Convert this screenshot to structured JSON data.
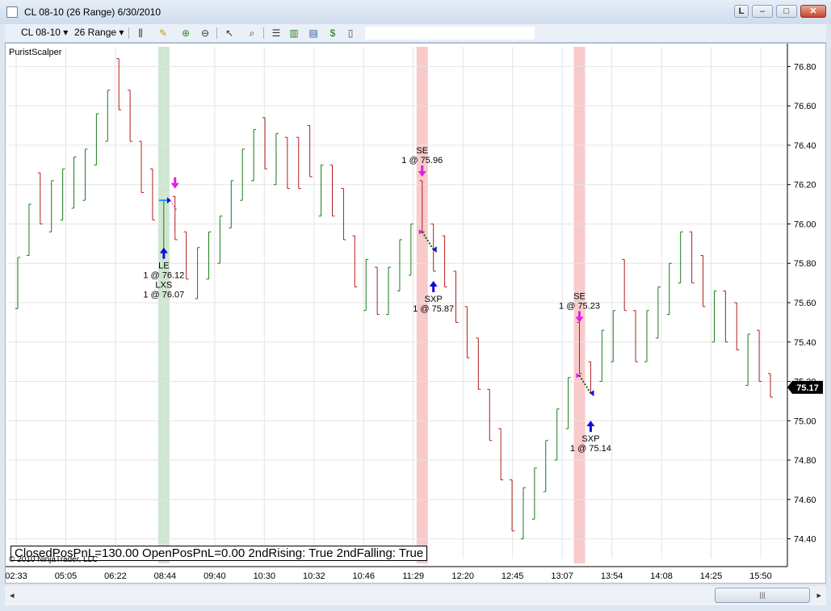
{
  "window": {
    "title": "CL 08-10 (26 Range)  6/30/2010"
  },
  "toolbar": {
    "instrument": "CL 08-10",
    "period": "26 Range"
  },
  "chart": {
    "strategy_label": "PuristScalper",
    "status_text": "ClosedPosPnL=130.00 OpenPosPnL=0.00 2ndRising: True 2ndFalling: True",
    "copyright": "© 2010 NinjaTrader, LLC",
    "last_price": "75.17"
  },
  "colors": {
    "up_bar": "#1a7a1a",
    "down_bar": "#b31d1d",
    "long_highlight": "#cfe6cf",
    "short_highlight": "#f8caca",
    "entry_arrow": "#e020e0",
    "exit_arrow": "#1010d0"
  },
  "chart_data": {
    "type": "range-bar",
    "y_axis": {
      "ticks": [
        "74.40",
        "74.60",
        "74.80",
        "75.00",
        "75.20",
        "75.40",
        "75.60",
        "75.80",
        "76.00",
        "76.20",
        "76.40",
        "76.60",
        "76.80"
      ],
      "ylim": [
        74.3,
        76.9
      ],
      "grid": true
    },
    "x_axis": {
      "ticks": [
        "02:33",
        "05:05",
        "06:22",
        "08:44",
        "09:40",
        "10:30",
        "10:32",
        "10:46",
        "11:29",
        "12:20",
        "12:45",
        "13:07",
        "13:54",
        "14:08",
        "14:25",
        "15:50"
      ]
    },
    "bars": [
      {
        "d": "up",
        "o": 75.57,
        "c": 75.83,
        "h": 75.83,
        "l": 75.57
      },
      {
        "d": "up",
        "o": 75.84,
        "c": 76.1,
        "h": 76.1,
        "l": 75.84
      },
      {
        "d": "down",
        "o": 76.26,
        "c": 76.0,
        "h": 76.26,
        "l": 76.0
      },
      {
        "d": "up",
        "o": 75.96,
        "c": 76.22,
        "h": 76.22,
        "l": 75.96
      },
      {
        "d": "up",
        "o": 76.02,
        "c": 76.28,
        "h": 76.28,
        "l": 76.02
      },
      {
        "d": "up",
        "o": 76.08,
        "c": 76.34,
        "h": 76.34,
        "l": 76.08
      },
      {
        "d": "up",
        "o": 76.12,
        "c": 76.38,
        "h": 76.38,
        "l": 76.12
      },
      {
        "d": "up",
        "o": 76.3,
        "c": 76.56,
        "h": 76.56,
        "l": 76.3
      },
      {
        "d": "up",
        "o": 76.42,
        "c": 76.68,
        "h": 76.68,
        "l": 76.42
      },
      {
        "d": "down",
        "o": 76.84,
        "c": 76.58,
        "h": 76.84,
        "l": 76.58
      },
      {
        "d": "down",
        "o": 76.68,
        "c": 76.42,
        "h": 76.68,
        "l": 76.42
      },
      {
        "d": "down",
        "o": 76.42,
        "c": 76.16,
        "h": 76.42,
        "l": 76.16
      },
      {
        "d": "down",
        "o": 76.28,
        "c": 76.02,
        "h": 76.28,
        "l": 76.02
      },
      {
        "d": "up",
        "o": 75.86,
        "c": 76.12,
        "h": 76.12,
        "l": 75.86
      },
      {
        "d": "down",
        "o": 76.14,
        "c": 75.92,
        "h": 76.14,
        "l": 75.92
      },
      {
        "d": "down",
        "o": 75.96,
        "c": 75.72,
        "h": 75.96,
        "l": 75.72
      },
      {
        "d": "up",
        "o": 75.62,
        "c": 75.88,
        "h": 75.88,
        "l": 75.62
      },
      {
        "d": "up",
        "o": 75.72,
        "c": 75.96,
        "h": 75.96,
        "l": 75.72
      },
      {
        "d": "up",
        "o": 75.8,
        "c": 76.04,
        "h": 76.04,
        "l": 75.8
      },
      {
        "d": "up",
        "o": 75.98,
        "c": 76.22,
        "h": 76.22,
        "l": 75.98
      },
      {
        "d": "up",
        "o": 76.12,
        "c": 76.38,
        "h": 76.38,
        "l": 76.12
      },
      {
        "d": "up",
        "o": 76.22,
        "c": 76.48,
        "h": 76.48,
        "l": 76.22
      },
      {
        "d": "down",
        "o": 76.54,
        "c": 76.28,
        "h": 76.54,
        "l": 76.28
      },
      {
        "d": "up",
        "o": 76.2,
        "c": 76.46,
        "h": 76.46,
        "l": 76.2
      },
      {
        "d": "down",
        "o": 76.44,
        "c": 76.18,
        "h": 76.44,
        "l": 76.18
      },
      {
        "d": "down",
        "o": 76.44,
        "c": 76.18,
        "h": 76.44,
        "l": 76.18
      },
      {
        "d": "down",
        "o": 76.5,
        "c": 76.24,
        "h": 76.5,
        "l": 76.24
      },
      {
        "d": "up",
        "o": 76.04,
        "c": 76.3,
        "h": 76.3,
        "l": 76.04
      },
      {
        "d": "down",
        "o": 76.3,
        "c": 76.04,
        "h": 76.3,
        "l": 76.04
      },
      {
        "d": "down",
        "o": 76.18,
        "c": 75.92,
        "h": 76.18,
        "l": 75.92
      },
      {
        "d": "down",
        "o": 75.94,
        "c": 75.68,
        "h": 75.94,
        "l": 75.68
      },
      {
        "d": "up",
        "o": 75.56,
        "c": 75.82,
        "h": 75.82,
        "l": 75.56
      },
      {
        "d": "down",
        "o": 75.78,
        "c": 75.54,
        "h": 75.78,
        "l": 75.54
      },
      {
        "d": "up",
        "o": 75.54,
        "c": 75.78,
        "h": 75.78,
        "l": 75.54
      },
      {
        "d": "up",
        "o": 75.66,
        "c": 75.92,
        "h": 75.92,
        "l": 75.66
      },
      {
        "d": "up",
        "o": 75.74,
        "c": 76.0,
        "h": 76.0,
        "l": 75.74
      },
      {
        "d": "down",
        "o": 76.22,
        "c": 75.96,
        "h": 76.22,
        "l": 75.96
      },
      {
        "d": "down",
        "o": 76.0,
        "c": 75.76,
        "h": 76.0,
        "l": 75.76
      },
      {
        "d": "down",
        "o": 75.94,
        "c": 75.68,
        "h": 75.94,
        "l": 75.68
      },
      {
        "d": "down",
        "o": 75.76,
        "c": 75.5,
        "h": 75.76,
        "l": 75.5
      },
      {
        "d": "down",
        "o": 75.58,
        "c": 75.32,
        "h": 75.58,
        "l": 75.32
      },
      {
        "d": "down",
        "o": 75.42,
        "c": 75.16,
        "h": 75.42,
        "l": 75.16
      },
      {
        "d": "down",
        "o": 75.16,
        "c": 74.9,
        "h": 75.16,
        "l": 74.9
      },
      {
        "d": "down",
        "o": 74.96,
        "c": 74.7,
        "h": 74.96,
        "l": 74.7
      },
      {
        "d": "down",
        "o": 74.7,
        "c": 74.44,
        "h": 74.7,
        "l": 74.44
      },
      {
        "d": "up",
        "o": 74.4,
        "c": 74.66,
        "h": 74.66,
        "l": 74.4
      },
      {
        "d": "up",
        "o": 74.5,
        "c": 74.76,
        "h": 74.76,
        "l": 74.5
      },
      {
        "d": "up",
        "o": 74.64,
        "c": 74.9,
        "h": 74.9,
        "l": 74.64
      },
      {
        "d": "up",
        "o": 74.8,
        "c": 75.06,
        "h": 75.06,
        "l": 74.8
      },
      {
        "d": "up",
        "o": 74.96,
        "c": 75.22,
        "h": 75.22,
        "l": 74.96
      },
      {
        "d": "down",
        "o": 75.5,
        "c": 75.24,
        "h": 75.5,
        "l": 75.24
      },
      {
        "d": "down",
        "o": 75.3,
        "c": 75.14,
        "h": 75.3,
        "l": 75.14
      },
      {
        "d": "up",
        "o": 75.2,
        "c": 75.46,
        "h": 75.46,
        "l": 75.2
      },
      {
        "d": "up",
        "o": 75.3,
        "c": 75.56,
        "h": 75.56,
        "l": 75.3
      },
      {
        "d": "down",
        "o": 75.82,
        "c": 75.56,
        "h": 75.82,
        "l": 75.56
      },
      {
        "d": "down",
        "o": 75.56,
        "c": 75.3,
        "h": 75.56,
        "l": 75.3
      },
      {
        "d": "up",
        "o": 75.3,
        "c": 75.56,
        "h": 75.56,
        "l": 75.3
      },
      {
        "d": "up",
        "o": 75.42,
        "c": 75.68,
        "h": 75.68,
        "l": 75.42
      },
      {
        "d": "up",
        "o": 75.54,
        "c": 75.8,
        "h": 75.8,
        "l": 75.54
      },
      {
        "d": "up",
        "o": 75.7,
        "c": 75.96,
        "h": 75.96,
        "l": 75.7
      },
      {
        "d": "down",
        "o": 75.96,
        "c": 75.7,
        "h": 75.96,
        "l": 75.7
      },
      {
        "d": "down",
        "o": 75.84,
        "c": 75.58,
        "h": 75.84,
        "l": 75.58
      },
      {
        "d": "up",
        "o": 75.4,
        "c": 75.66,
        "h": 75.66,
        "l": 75.4
      },
      {
        "d": "down",
        "o": 75.66,
        "c": 75.4,
        "h": 75.66,
        "l": 75.4
      },
      {
        "d": "down",
        "o": 75.6,
        "c": 75.36,
        "h": 75.6,
        "l": 75.36
      },
      {
        "d": "up",
        "o": 75.18,
        "c": 75.44,
        "h": 75.44,
        "l": 75.18
      },
      {
        "d": "down",
        "o": 75.46,
        "c": 75.2,
        "h": 75.46,
        "l": 75.2
      },
      {
        "d": "down",
        "o": 75.24,
        "c": 75.12,
        "h": 75.24,
        "l": 75.12
      }
    ],
    "highlights": [
      {
        "type": "long",
        "bar": 13
      },
      {
        "type": "short",
        "bar": 36
      },
      {
        "type": "short",
        "bar": 50
      }
    ],
    "signals": [
      {
        "bar": 14,
        "kind": "entry-down",
        "price": 76.2,
        "label": []
      },
      {
        "bar": 13,
        "kind": "exit-up",
        "price": 75.86,
        "label": [
          "LE",
          "1 @ 76.12",
          "LXS",
          "1 @ 76.07"
        ]
      },
      {
        "bar": 36,
        "kind": "entry-down",
        "price": 76.26,
        "label": [
          "SE",
          "1 @ 75.96"
        ]
      },
      {
        "bar": 37,
        "kind": "exit-up",
        "price": 75.69,
        "label": [
          "SXP",
          "1 @ 75.87"
        ]
      },
      {
        "bar": 50,
        "kind": "entry-down",
        "price": 75.52,
        "label": [
          "SE",
          "1 @ 75.23"
        ]
      },
      {
        "bar": 51,
        "kind": "exit-up",
        "price": 74.98,
        "label": [
          "SXP",
          "1 @ 75.14"
        ]
      }
    ],
    "trade_lines": [
      {
        "from_bar": 13,
        "from_price": 76.12,
        "to_bar": 14,
        "to_price": 76.07,
        "style": "long"
      },
      {
        "from_bar": 36,
        "from_price": 75.96,
        "to_bar": 37,
        "to_price": 75.87,
        "style": "short"
      },
      {
        "from_bar": 50,
        "from_price": 75.23,
        "to_bar": 51,
        "to_price": 75.14,
        "style": "short"
      }
    ]
  }
}
